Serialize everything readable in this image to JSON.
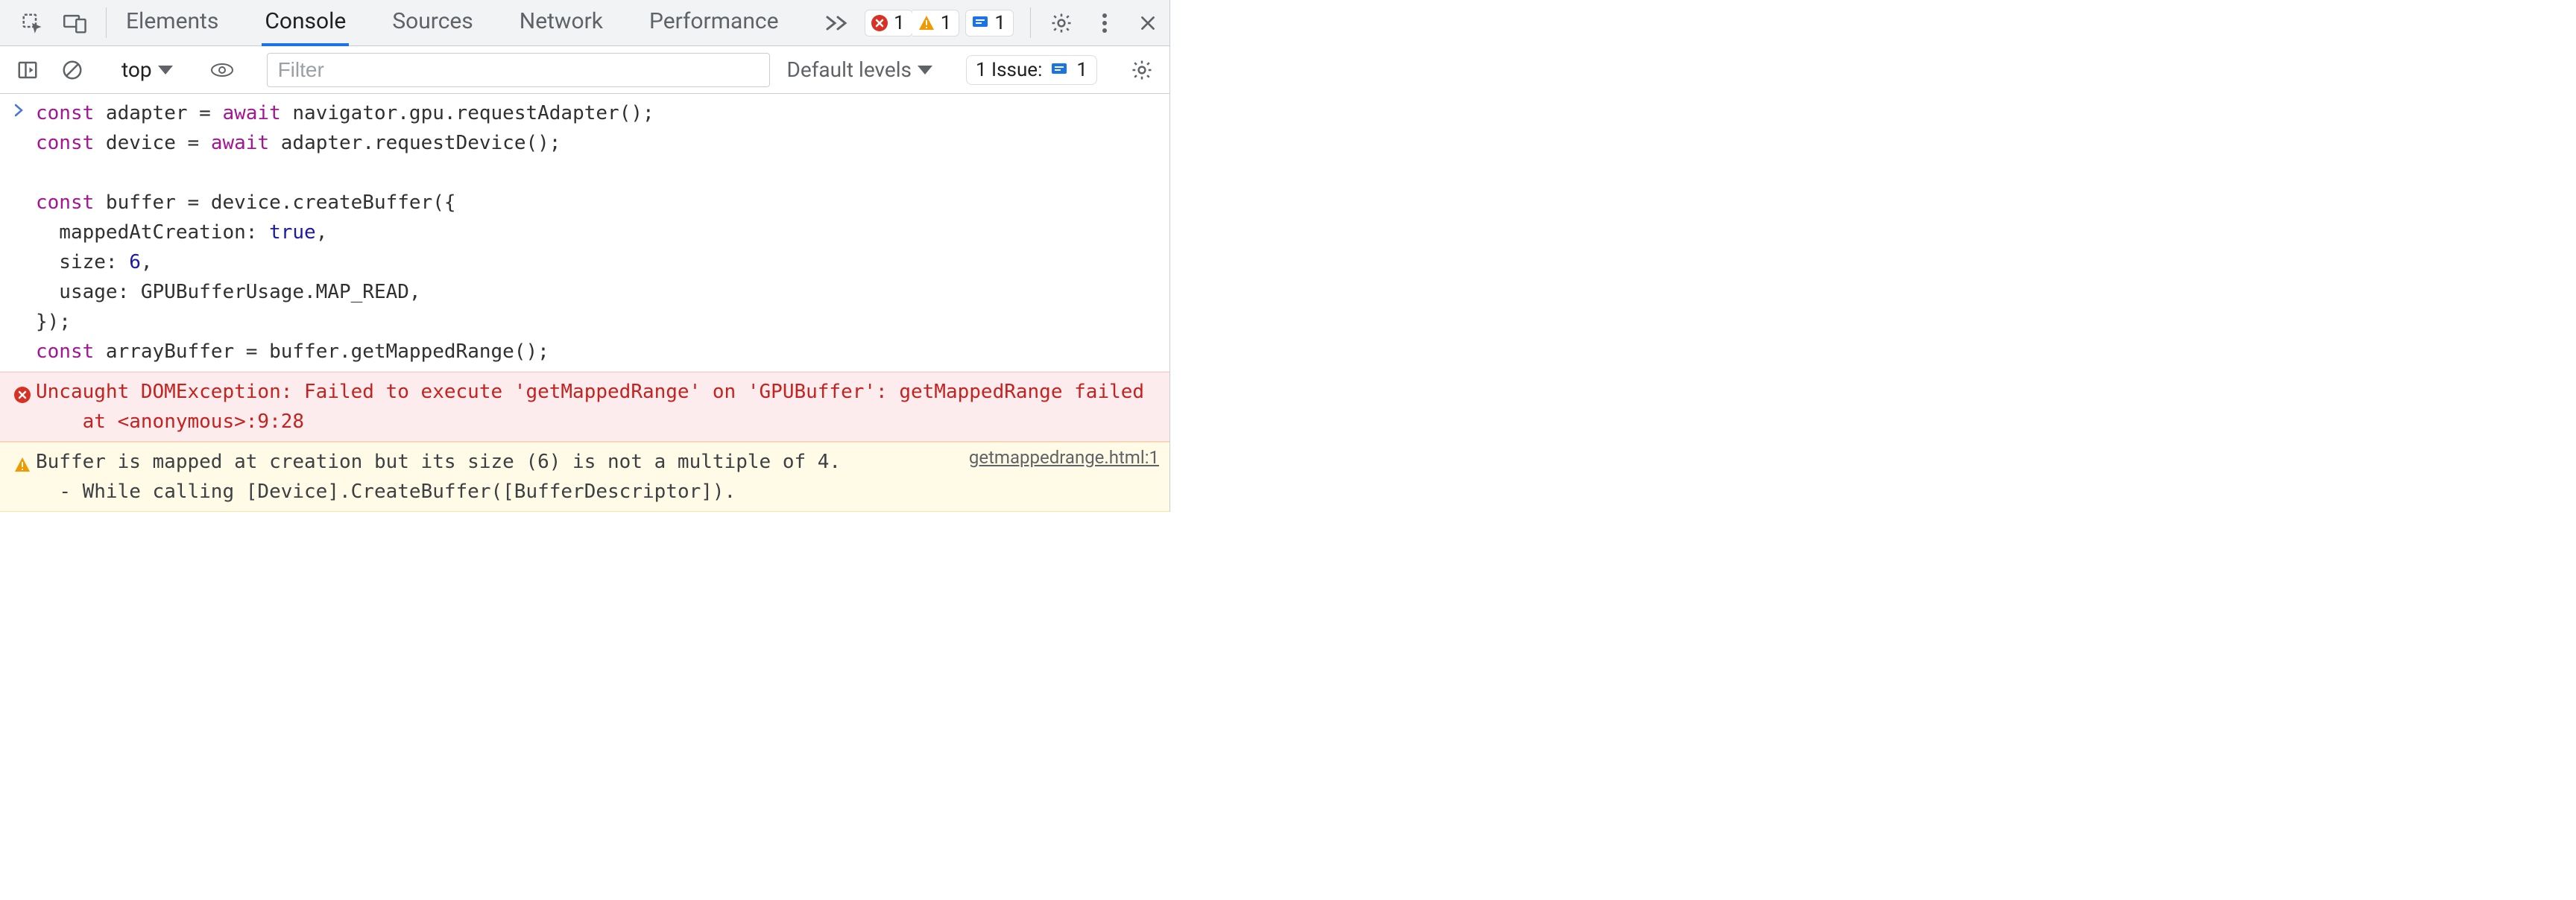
{
  "tabs": {
    "items": [
      "Elements",
      "Console",
      "Sources",
      "Network",
      "Performance"
    ],
    "active_index": 1
  },
  "counters": {
    "errors": "1",
    "warnings": "1",
    "info": "1"
  },
  "toolbar": {
    "context_label": "top",
    "filter_placeholder": "Filter",
    "levels_label": "Default levels",
    "issues_label": "1 Issue:",
    "issues_count": "1"
  },
  "console": {
    "input_code": "const adapter = await navigator.gpu.requestAdapter();\nconst device = await adapter.requestDevice();\n\nconst buffer = device.createBuffer({\n  mappedAtCreation: true,\n  size: 6,\n  usage: GPUBufferUsage.MAP_READ,\n});\nconst arrayBuffer = buffer.getMappedRange();",
    "error_text": "Uncaught DOMException: Failed to execute 'getMappedRange' on 'GPUBuffer': getMappedRange failed\n    at <anonymous>:9:28",
    "warn_text": "Buffer is mapped at creation but its size (6) is not a multiple of 4.\n  - While calling [Device].CreateBuffer([BufferDescriptor]).",
    "warn_source": "getmappedrange.html:1"
  }
}
